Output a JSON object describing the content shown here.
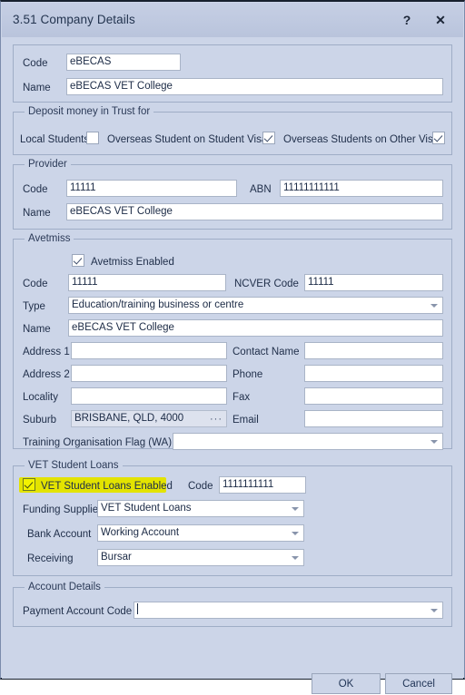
{
  "window": {
    "title": "3.51 Company Details",
    "help_icon": "?",
    "close_icon": "✕"
  },
  "company": {
    "code_label": "Code",
    "code_value": "eBECAS",
    "name_label": "Name",
    "name_value": "eBECAS VET College"
  },
  "deposit": {
    "group_title": "Deposit money in Trust for",
    "local_students_label": "Local Students",
    "local_students_checked": false,
    "overseas_student_visa_label": "Overseas Student on Student Visa",
    "overseas_student_visa_checked": true,
    "overseas_other_visa_label": "Overseas Students on Other Visa",
    "overseas_other_visa_checked": true
  },
  "provider": {
    "group_title": "Provider",
    "code_label": "Code",
    "code_value": "11111",
    "abn_label": "ABN",
    "abn_value": "11111111111",
    "name_label": "Name",
    "name_value": "eBECAS VET College"
  },
  "avetmiss": {
    "group_title": "Avetmiss",
    "enabled_label": "Avetmiss Enabled",
    "enabled_checked": true,
    "code_label": "Code",
    "code_value": "11111",
    "ncver_label": "NCVER Code",
    "ncver_value": "11111",
    "type_label": "Type",
    "type_value": "Education/training business or centre",
    "name_label": "Name",
    "name_value": "eBECAS VET College",
    "address1_label": "Address 1",
    "address1_value": "",
    "address2_label": "Address 2",
    "address2_value": "",
    "locality_label": "Locality",
    "locality_value": "",
    "suburb_label": "Suburb",
    "suburb_value": "BRISBANE, QLD, 4000",
    "suburb_browse": "···",
    "contact_name_label": "Contact Name",
    "contact_name_value": "",
    "phone_label": "Phone",
    "phone_value": "",
    "fax_label": "Fax",
    "fax_value": "",
    "email_label": "Email",
    "email_value": "",
    "training_flag_label": "Training Organisation Flag (WA)",
    "training_flag_value": ""
  },
  "vsl": {
    "group_title": "VET Student Loans",
    "enabled_label": "VET Student Loans Enabled",
    "enabled_checked": true,
    "highlight_color": "#e3e300",
    "code_label": "Code",
    "code_value": "1111111111",
    "funding_supplier_label": "Funding Supplier",
    "funding_supplier_value": "VET Student Loans",
    "bank_account_label": "Bank Account",
    "bank_account_value": "Working Account",
    "receiving_label": "Receiving",
    "receiving_value": "Bursar"
  },
  "account_details": {
    "group_title": "Account Details",
    "payment_account_code_label": "Payment Account Code",
    "payment_account_code_value": ""
  },
  "buttons": {
    "ok_label": "OK",
    "cancel_label": "Cancel"
  }
}
